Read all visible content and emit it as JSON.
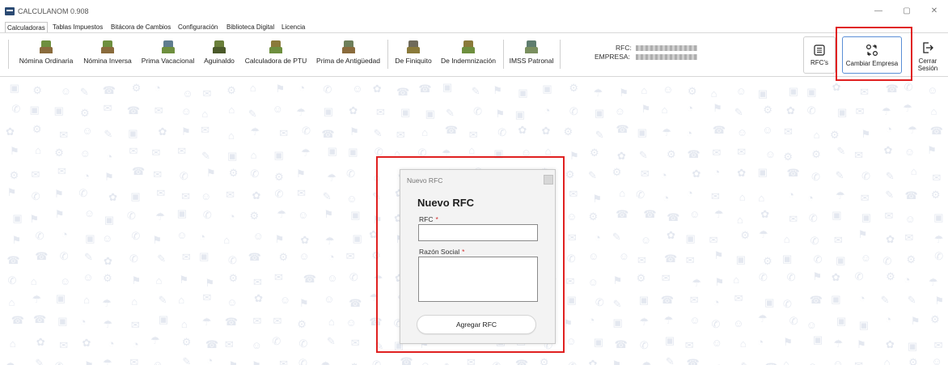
{
  "window": {
    "title": "CALCULANOM 0.908",
    "controls": {
      "minimize": "—",
      "restore": "▢",
      "close": "✕"
    }
  },
  "menu": [
    {
      "label": "Calculadoras",
      "active": true
    },
    {
      "label": "Tablas Impuestos"
    },
    {
      "label": "Bitácora de Cambios"
    },
    {
      "label": "Configuración"
    },
    {
      "label": "Biblioteca Digital"
    },
    {
      "label": "Licencia"
    }
  ],
  "ribbon": {
    "buttons": [
      {
        "label": "Nómina Ordinaria",
        "icon": "people-icon",
        "color": "#6e8f3e"
      },
      {
        "label": "Nómina Inversa",
        "icon": "people-icon",
        "color": "#6e8f3e"
      },
      {
        "label": "Prima Vacacional",
        "icon": "vacation-icon",
        "color": "#5f7d8f"
      },
      {
        "label": "Aguinaldo",
        "icon": "bonus-icon",
        "color": "#6a7f3a"
      },
      {
        "label": "Calculadora de PTU",
        "icon": "profit-sharing-icon",
        "color": "#8a7a3a"
      },
      {
        "label": "Prima de Antigüedad",
        "icon": "seniority-icon",
        "color": "#6e7f5a"
      },
      {
        "label": "De Finiquito",
        "icon": "settlement-icon",
        "color": "#6f6a5a"
      },
      {
        "label": "De Indemnización",
        "icon": "compensation-icon",
        "color": "#8a7a3a"
      },
      {
        "label": "IMSS Patronal",
        "icon": "imss-icon",
        "color": "#5f7d6f"
      }
    ],
    "rfc_label": "RFC:",
    "empresa_label": "EMPRESA:"
  },
  "side": {
    "rfcs_label": "RFC's",
    "cambiar_label": "Cambiar Empresa",
    "cerrar_line1": "Cerrar",
    "cerrar_line2": "Sesión"
  },
  "dialog": {
    "title": "Nuevo RFC",
    "heading": "Nuevo RFC",
    "rfc_label": "RFC",
    "rfc_value": "",
    "razon_label": "Razón Social",
    "razon_value": "",
    "required_mark": "*",
    "button": "Agregar RFC"
  },
  "colors": {
    "highlight": "#e02020",
    "accent": "#2b4a73"
  }
}
